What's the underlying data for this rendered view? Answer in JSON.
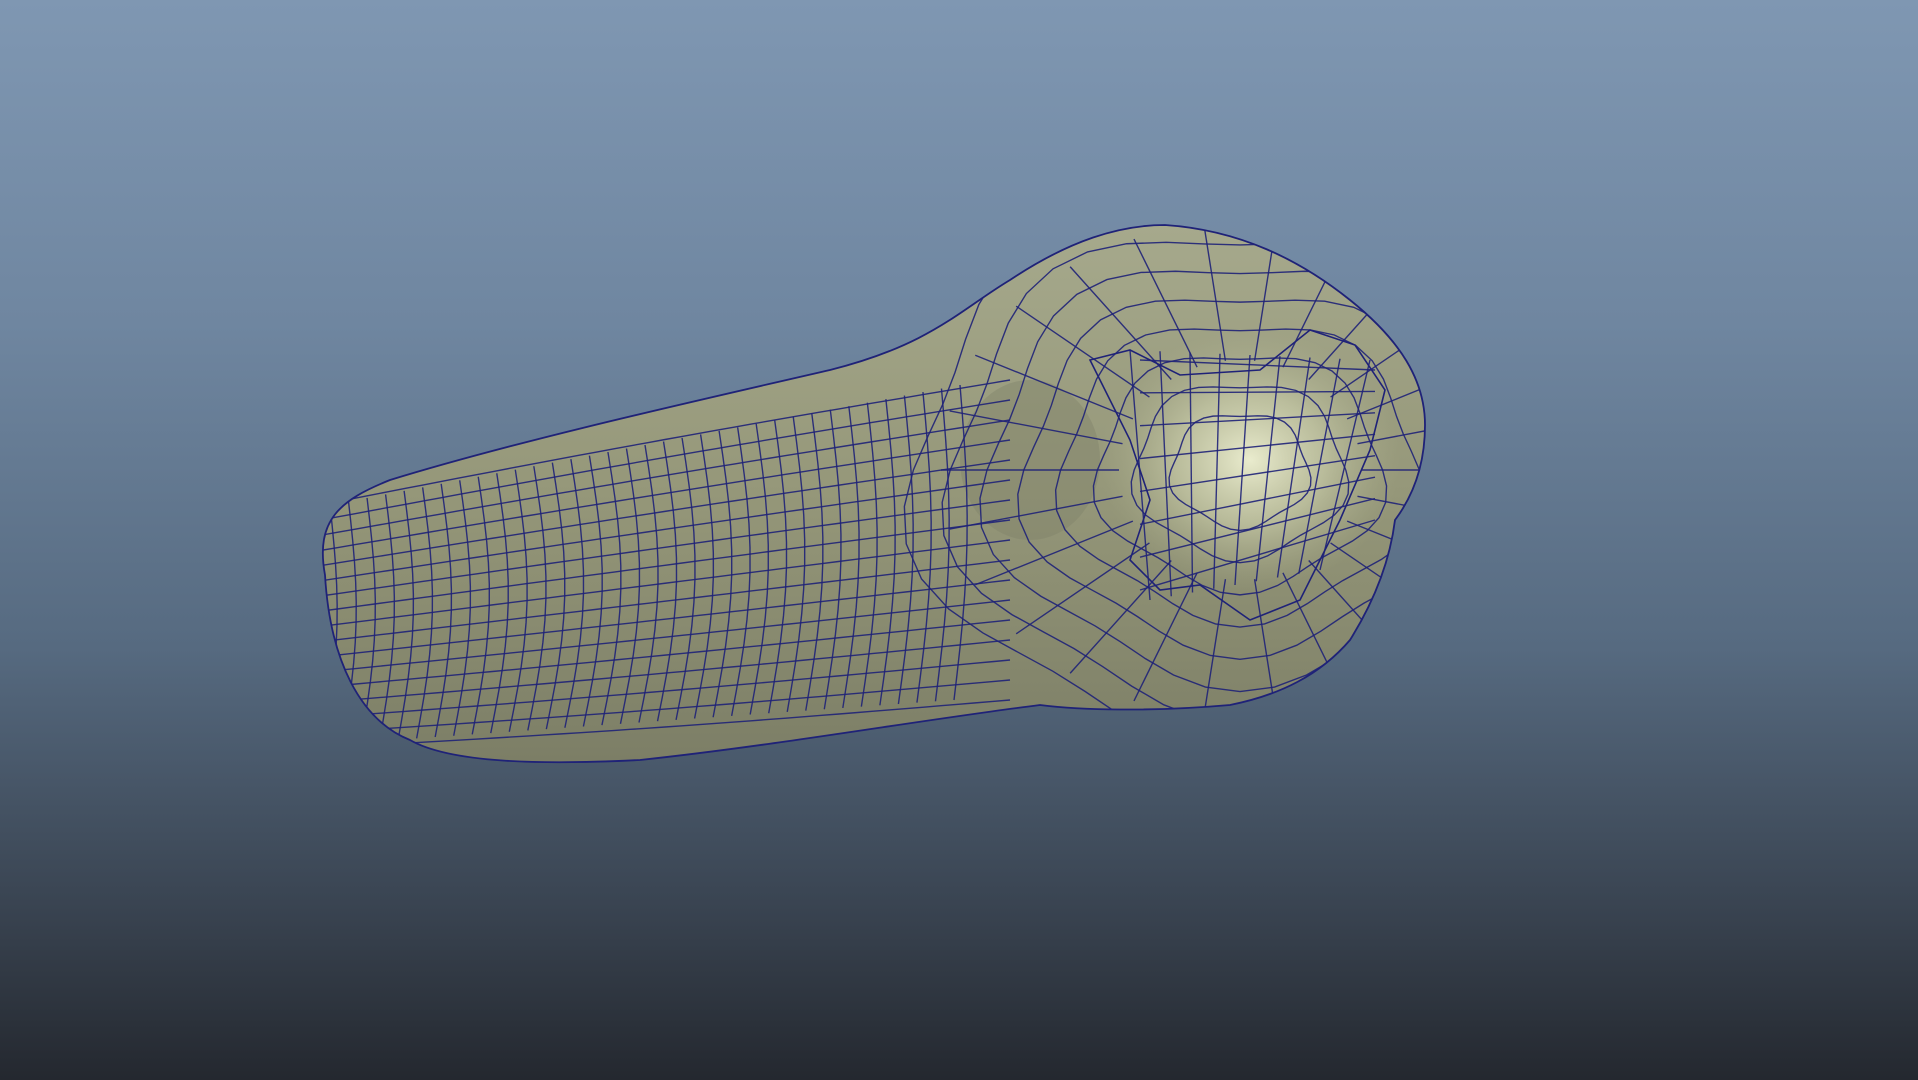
{
  "viewport": {
    "background_top": "#7f97b2",
    "background_bottom": "#24282f"
  },
  "model": {
    "shape": "subdivided-polygon-mesh",
    "display_mode": "shaded-with-wireframe",
    "surface_color": "#9a9c80",
    "highlight_color": "#e4e6c6",
    "wire_color": "#1f2278"
  }
}
